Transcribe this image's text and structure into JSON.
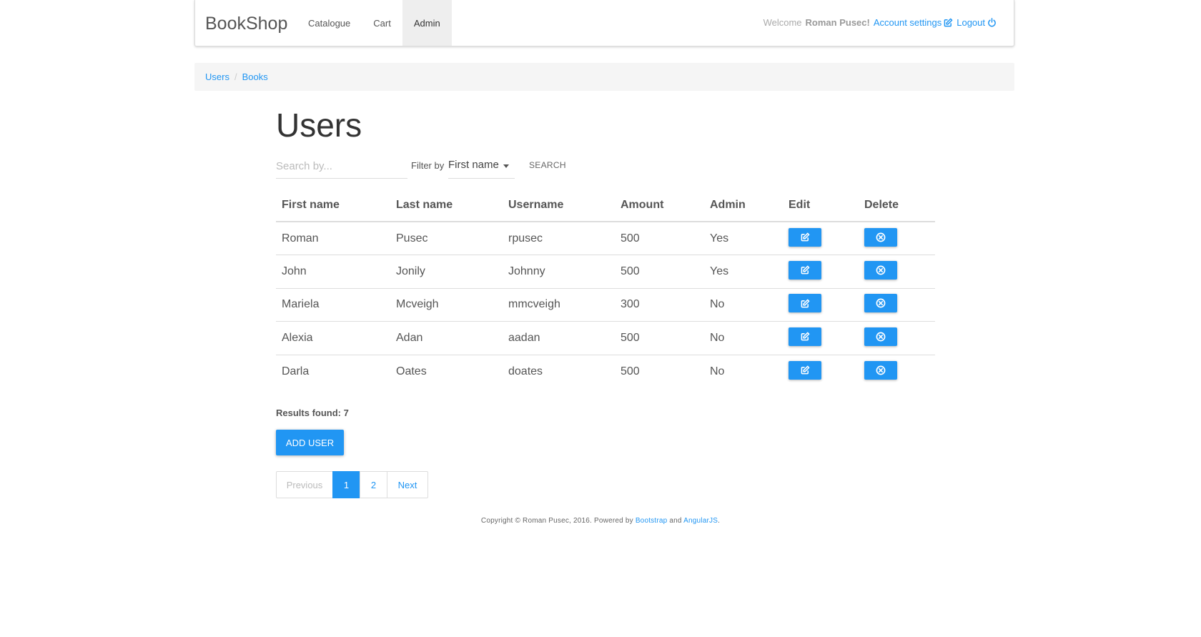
{
  "brand": "BookShop",
  "nav": {
    "links": [
      "Catalogue",
      "Cart",
      "Admin"
    ],
    "active": "Admin",
    "welcome_prefix": "Welcome",
    "user_name": "Roman Pusec!",
    "account_settings": "Account settings",
    "logout": "Logout"
  },
  "breadcrumb": [
    "Users",
    "Books"
  ],
  "page_title": "Users",
  "search": {
    "placeholder": "Search by...",
    "value": "",
    "filter_label": "Filter by",
    "filter_value": "First name",
    "button": "SEARCH"
  },
  "table": {
    "headers": [
      "First name",
      "Last name",
      "Username",
      "Amount",
      "Admin",
      "Edit",
      "Delete"
    ],
    "rows": [
      [
        "Roman",
        "Pusec",
        "rpusec",
        "500",
        "Yes"
      ],
      [
        "John",
        "Jonily",
        "Johnny",
        "500",
        "Yes"
      ],
      [
        "Mariela",
        "Mcveigh",
        "mmcveigh",
        "300",
        "No"
      ],
      [
        "Alexia",
        "Adan",
        "aadan",
        "500",
        "No"
      ],
      [
        "Darla",
        "Oates",
        "doates",
        "500",
        "No"
      ]
    ]
  },
  "results": "Results found: 7",
  "add_user": "ADD USER",
  "pagination": {
    "previous": "Previous",
    "pages": [
      "1",
      "2"
    ],
    "current": "1",
    "next": "Next"
  },
  "footer": {
    "text": "Copyright © Roman Pusec, 2016. Powered by",
    "link1": "Bootstrap",
    "and": "and",
    "link2": "AngularJS",
    "end": "."
  },
  "colors": {
    "accent": "#2196f3",
    "active_nav_bg": "#eeeeee",
    "breadcrumb_bg": "#f5f5f5"
  },
  "icons": {
    "edit": "edit-icon",
    "delete": "times-circle-icon",
    "logout": "power-icon",
    "account": "edit-icon"
  }
}
